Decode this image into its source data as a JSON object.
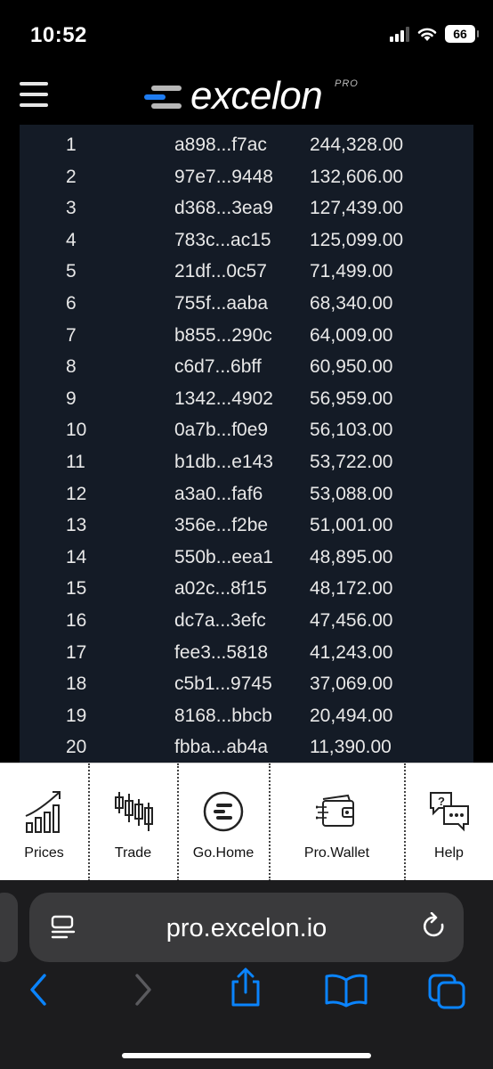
{
  "status": {
    "time": "10:52",
    "battery": "66"
  },
  "header": {
    "logo_text": "excelon",
    "logo_badge": "PRO",
    "logo_colors": {
      "blue": "#1e7cf2",
      "gray": "#b7b7b7"
    }
  },
  "table": {
    "rows": [
      {
        "rank": "1",
        "address": "a898...f7ac",
        "amount": "244,328.00"
      },
      {
        "rank": "2",
        "address": "97e7...9448",
        "amount": "132,606.00"
      },
      {
        "rank": "3",
        "address": "d368...3ea9",
        "amount": "127,439.00"
      },
      {
        "rank": "4",
        "address": "783c...ac15",
        "amount": "125,099.00"
      },
      {
        "rank": "5",
        "address": "21df...0c57",
        "amount": "71,499.00"
      },
      {
        "rank": "6",
        "address": "755f...aaba",
        "amount": "68,340.00"
      },
      {
        "rank": "7",
        "address": "b855...290c",
        "amount": "64,009.00"
      },
      {
        "rank": "8",
        "address": "c6d7...6bff",
        "amount": "60,950.00"
      },
      {
        "rank": "9",
        "address": "1342...4902",
        "amount": "56,959.00"
      },
      {
        "rank": "10",
        "address": "0a7b...f0e9",
        "amount": "56,103.00"
      },
      {
        "rank": "11",
        "address": "b1db...e143",
        "amount": "53,722.00"
      },
      {
        "rank": "12",
        "address": "a3a0...faf6",
        "amount": "53,088.00"
      },
      {
        "rank": "13",
        "address": "356e...f2be",
        "amount": "51,001.00"
      },
      {
        "rank": "14",
        "address": "550b...eea1",
        "amount": "48,895.00"
      },
      {
        "rank": "15",
        "address": "a02c...8f15",
        "amount": "48,172.00"
      },
      {
        "rank": "16",
        "address": "dc7a...3efc",
        "amount": "47,456.00"
      },
      {
        "rank": "17",
        "address": "fee3...5818",
        "amount": "41,243.00"
      },
      {
        "rank": "18",
        "address": "c5b1...9745",
        "amount": "37,069.00"
      },
      {
        "rank": "19",
        "address": "8168...bbcb",
        "amount": "20,494.00"
      },
      {
        "rank": "20",
        "address": "fbba...ab4a",
        "amount": "11,390.00"
      }
    ]
  },
  "bottom_nav": {
    "items": [
      {
        "label": "Prices",
        "icon": "chart-growth-icon"
      },
      {
        "label": "Trade",
        "icon": "candlestick-icon"
      },
      {
        "label": "Go.Home",
        "icon": "excelon-home-icon"
      },
      {
        "label": "Pro.Wallet",
        "icon": "wallet-icon"
      },
      {
        "label": "Help",
        "icon": "help-chat-icon"
      }
    ]
  },
  "browser": {
    "url": "pro.excelon.io",
    "accent": "#0a84ff"
  }
}
